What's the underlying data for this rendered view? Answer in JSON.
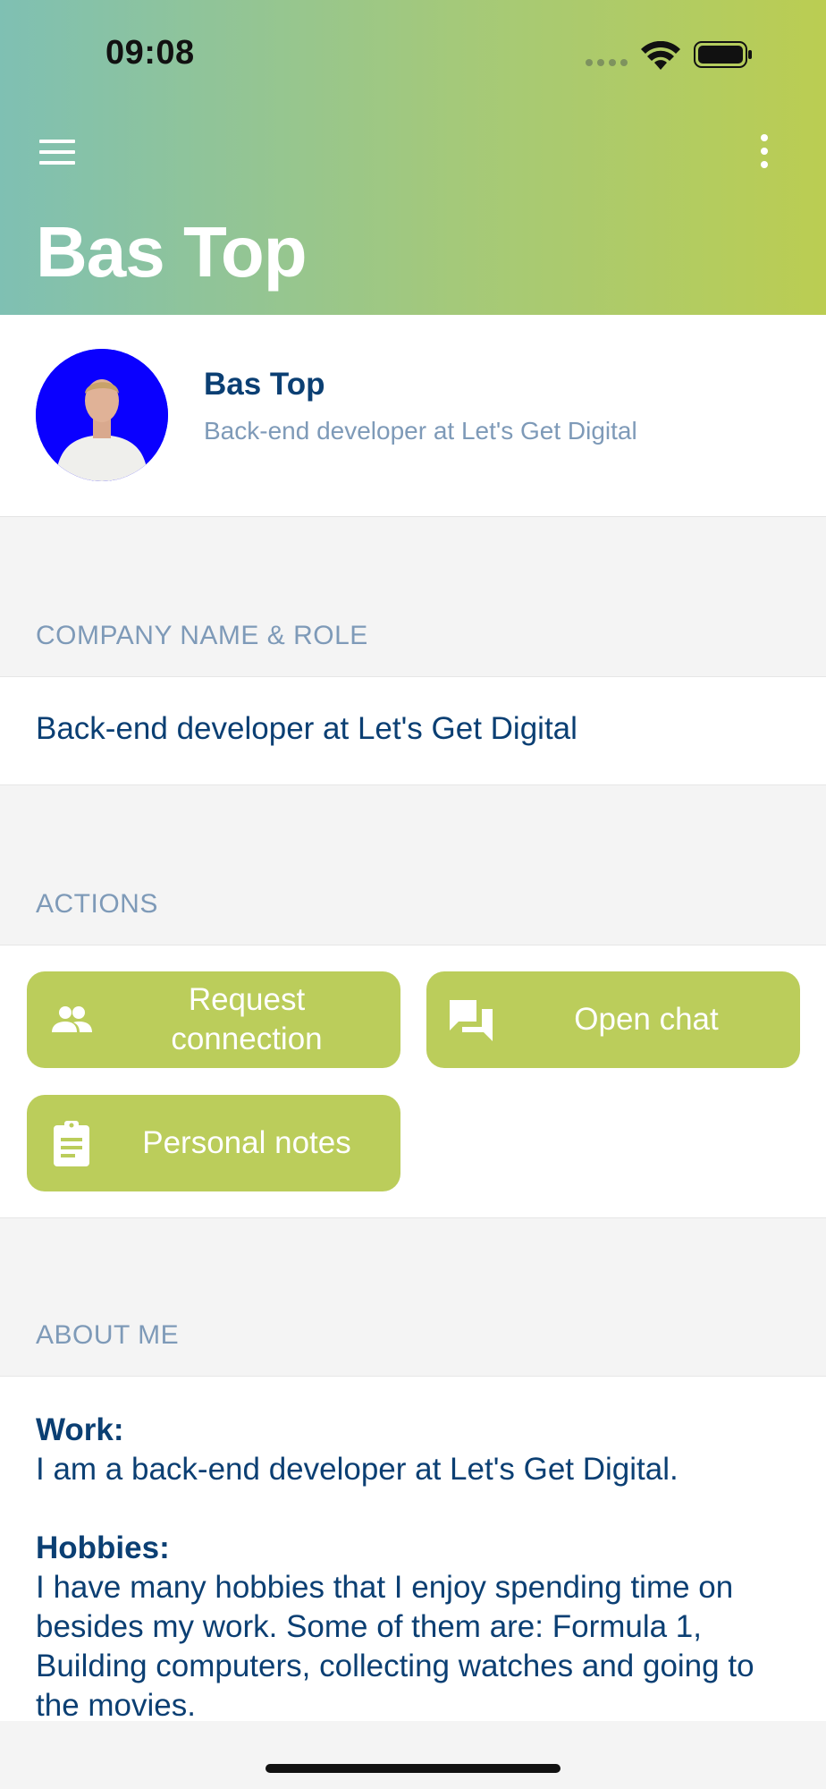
{
  "status_bar": {
    "time": "09:08"
  },
  "header": {
    "title": "Bas Top"
  },
  "profile": {
    "name": "Bas Top",
    "subtitle": "Back-end developer at Let's Get Digital"
  },
  "company": {
    "label": "COMPANY NAME & ROLE",
    "value": "Back-end developer at Let's Get Digital"
  },
  "actions": {
    "label": "ACTIONS",
    "request_connection": "Request connection",
    "open_chat": "Open chat",
    "personal_notes": "Personal notes"
  },
  "about": {
    "label": "ABOUT ME",
    "work_heading": "Work:",
    "work_text": "I am a back-end developer at Let's Get Digital.",
    "hobbies_heading": "Hobbies:",
    "hobbies_text": "I have many hobbies that I enjoy spending time on besides my work. Some of them are: Formula 1, Building computers, collecting watches and going to the movies."
  },
  "colors": {
    "header_gradient_start": "#7fc0b3",
    "header_gradient_end": "#bbcd52",
    "button": "#bbcd5b",
    "text_primary": "#0b3f73",
    "text_secondary": "#7e9ab8"
  }
}
